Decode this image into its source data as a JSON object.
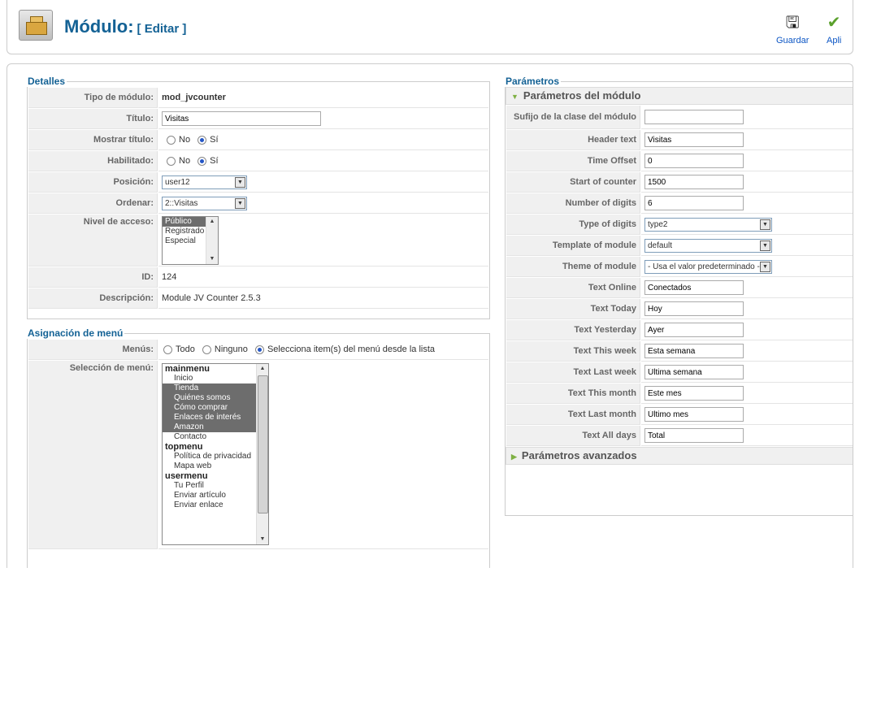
{
  "header": {
    "title": "Módulo:",
    "subtitle": "[ Editar ]",
    "buttons": [
      {
        "label": "Guardar",
        "icon": "save-icon"
      },
      {
        "label": "Apli",
        "icon": "apply-icon"
      }
    ]
  },
  "details": {
    "legend": "Detalles",
    "tipo_label": "Tipo de módulo:",
    "tipo_value": "mod_jvcounter",
    "titulo_label": "Título:",
    "titulo_value": "Visitas",
    "mostrar_label": "Mostrar título:",
    "no": "No",
    "si": "Sí",
    "habilitado_label": "Habilitado:",
    "posicion_label": "Posición:",
    "posicion_value": "user12",
    "ordenar_label": "Ordenar:",
    "ordenar_value": "2::Visitas",
    "acceso_label": "Nivel de acceso:",
    "acceso_options": [
      "Público",
      "Registrado",
      "Especial"
    ],
    "id_label": "ID:",
    "id_value": "124",
    "desc_label": "Descripción:",
    "desc_value": "Module JV Counter 2.5.3"
  },
  "menu": {
    "legend": "Asignación de menú",
    "menus_label": "Menús:",
    "opt_todo": "Todo",
    "opt_ninguno": "Ninguno",
    "opt_select": "Selecciona item(s) del menú desde la lista",
    "seleccion_label": "Selección de menú:",
    "list": [
      {
        "text": "mainmenu",
        "group": true
      },
      {
        "text": "Inicio"
      },
      {
        "text": "Tienda",
        "selected": true
      },
      {
        "text": "Quiénes somos",
        "selected": true
      },
      {
        "text": "Cómo comprar",
        "selected": true
      },
      {
        "text": "Enlaces de interés",
        "selected": true
      },
      {
        "text": "Amazon",
        "selected": true
      },
      {
        "text": "Contacto"
      },
      {
        "text": "topmenu",
        "group": true
      },
      {
        "text": "Política de privacidad"
      },
      {
        "text": "Mapa web"
      },
      {
        "text": "usermenu",
        "group": true
      },
      {
        "text": "Tu Perfil"
      },
      {
        "text": "Enviar artículo"
      },
      {
        "text": "Enviar enlace"
      }
    ]
  },
  "params": {
    "legend": "Parámetros",
    "module_params": "Parámetros del módulo",
    "advanced": "Parámetros avanzados",
    "rows": [
      {
        "label": "Sufijo de la clase del módulo",
        "value": "",
        "type": "text"
      },
      {
        "label": "Header text",
        "value": "Visitas",
        "type": "text"
      },
      {
        "label": "Time Offset",
        "value": "0",
        "type": "text"
      },
      {
        "label": "Start of counter",
        "value": "1500",
        "type": "text"
      },
      {
        "label": "Number of digits",
        "value": "6",
        "type": "text"
      },
      {
        "label": "Type of digits",
        "value": "type2",
        "type": "select"
      },
      {
        "label": "Template of module",
        "value": "default",
        "type": "select"
      },
      {
        "label": "Theme of module",
        "value": "- Usa el valor predeterminado -",
        "type": "select"
      },
      {
        "label": "Text Online",
        "value": "Conectados",
        "type": "text"
      },
      {
        "label": "Text Today",
        "value": "Hoy",
        "type": "text"
      },
      {
        "label": "Text Yesterday",
        "value": "Ayer",
        "type": "text"
      },
      {
        "label": "Text This week",
        "value": "Esta semana",
        "type": "text"
      },
      {
        "label": "Text Last week",
        "value": "Última semana",
        "type": "text"
      },
      {
        "label": "Text This month",
        "value": "Este mes",
        "type": "text"
      },
      {
        "label": "Text Last month",
        "value": "Último mes",
        "type": "text"
      },
      {
        "label": "Text All days",
        "value": "Total",
        "type": "text"
      }
    ]
  }
}
